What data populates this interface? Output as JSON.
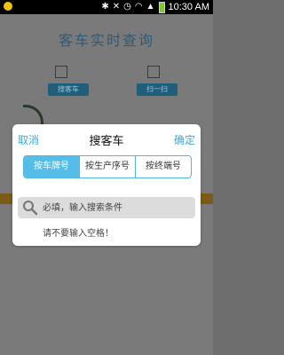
{
  "status_bar": {
    "time": "10:30 AM",
    "icons": [
      "app-notification-icon",
      "bluetooth-icon",
      "mute-icon",
      "alarm-icon",
      "wifi-icon",
      "signal-icon",
      "battery-icon"
    ]
  },
  "app": {
    "title": "客车实时查询",
    "button_1": "搜客车",
    "button_2": "扫一扫"
  },
  "dialog": {
    "cancel_label": "取消",
    "title": "搜客车",
    "confirm_label": "确定",
    "tabs": [
      {
        "label": "按车牌号",
        "active": true
      },
      {
        "label": "按生产序号",
        "active": false
      },
      {
        "label": "按终端号",
        "active": false
      }
    ],
    "search_placeholder": "必填，输入搜索条件",
    "hint": "请不要输入空格！"
  },
  "colors": {
    "accent": "#39a9dc",
    "tab_active": "#56bde9",
    "overlay": "#7a7a7a"
  }
}
